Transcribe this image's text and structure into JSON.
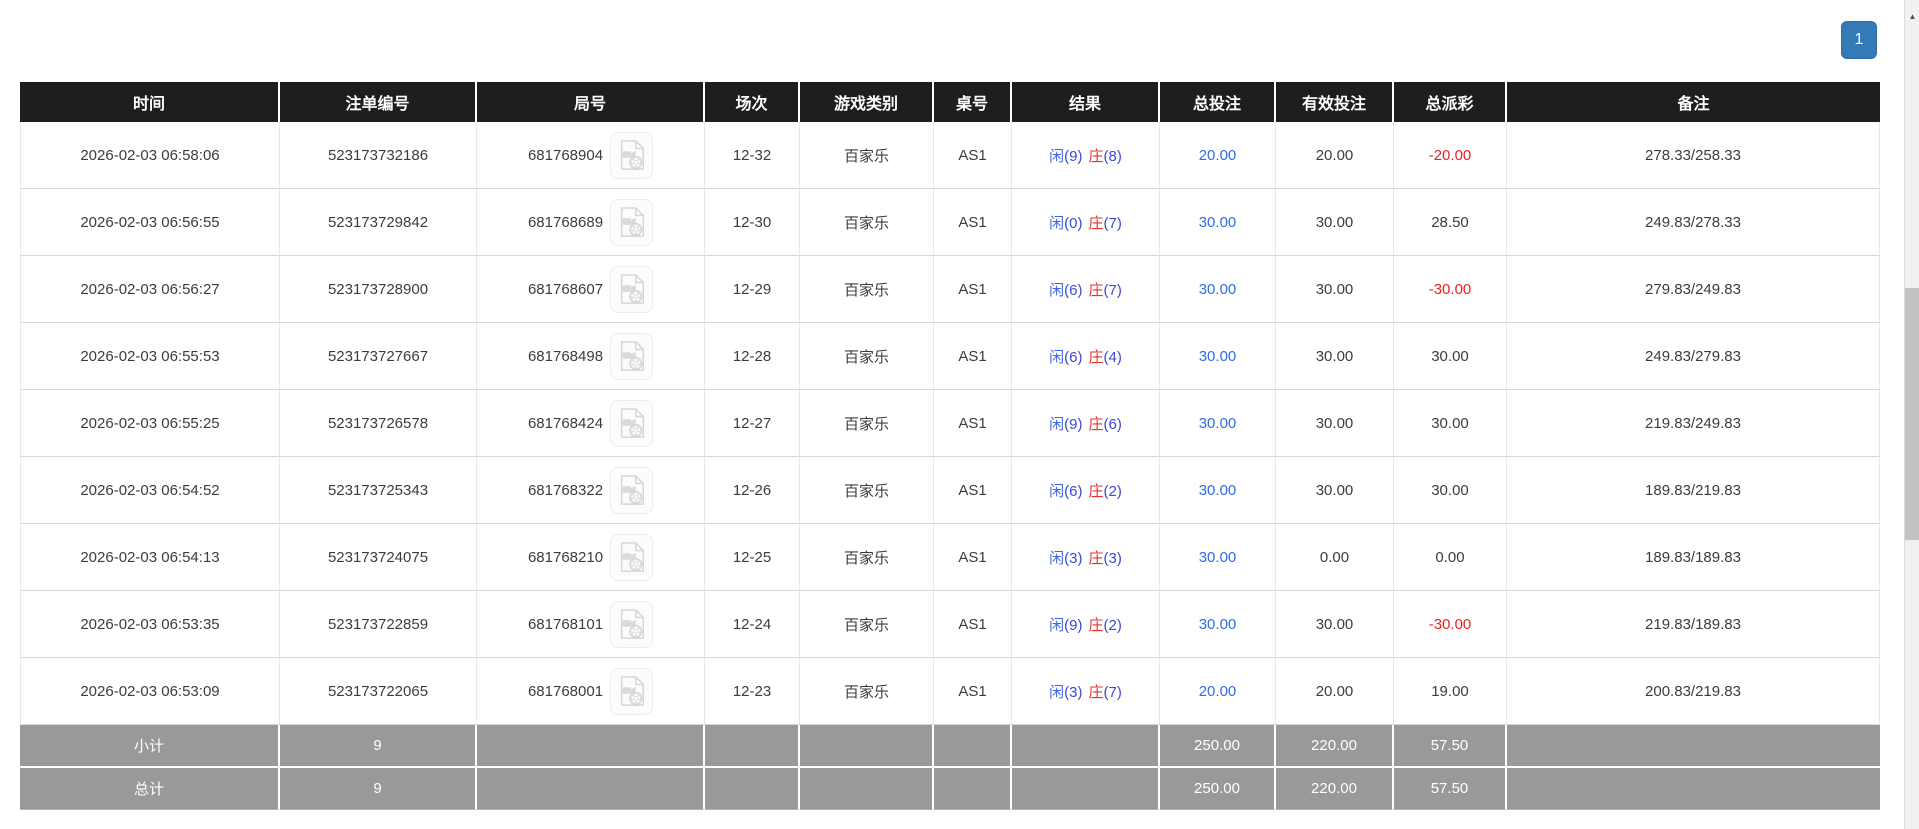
{
  "pagination": {
    "page_label": "1"
  },
  "icons": {
    "video_replay": "video-file-icon",
    "scroll_up": "▲"
  },
  "colors": {
    "header_bg": "#1e1e1e",
    "footer_bg": "#999999",
    "pagination_blue": "#337ab7",
    "total_bet_link_blue": "#2f6ce8",
    "player_blue": "#3f66e8",
    "banker_red": "#e23333",
    "negative_red": "#ef1f1f"
  },
  "table": {
    "headers": [
      "时间",
      "注单编号",
      "局号",
      "场次",
      "游戏类别",
      "桌号",
      "结果",
      "总投注",
      "有效投注",
      "总派彩",
      "备注"
    ],
    "rows": [
      {
        "time": "2026-02-03 06:58:06",
        "bet_id": "523173732186",
        "round_id": "681768904",
        "session": "12-32",
        "game_type": "百家乐",
        "table_no": "AS1",
        "player_label": "闲",
        "player_score": "(9)",
        "banker_label": "庄",
        "banker_score": "(8)",
        "total_bet": "20.00",
        "valid_bet": "20.00",
        "payout": "-20.00",
        "payout_class": "payout-neg",
        "remark": "278.33/258.33"
      },
      {
        "time": "2026-02-03 06:56:55",
        "bet_id": "523173729842",
        "round_id": "681768689",
        "session": "12-30",
        "game_type": "百家乐",
        "table_no": "AS1",
        "player_label": "闲",
        "player_score": "(0)",
        "banker_label": "庄",
        "banker_score": "(7)",
        "total_bet": "30.00",
        "valid_bet": "30.00",
        "payout": "28.50",
        "payout_class": "payout-pos",
        "remark": "249.83/278.33"
      },
      {
        "time": "2026-02-03 06:56:27",
        "bet_id": "523173728900",
        "round_id": "681768607",
        "session": "12-29",
        "game_type": "百家乐",
        "table_no": "AS1",
        "player_label": "闲",
        "player_score": "(6)",
        "banker_label": "庄",
        "banker_score": "(7)",
        "total_bet": "30.00",
        "valid_bet": "30.00",
        "payout": "-30.00",
        "payout_class": "payout-neg",
        "remark": "279.83/249.83"
      },
      {
        "time": "2026-02-03 06:55:53",
        "bet_id": "523173727667",
        "round_id": "681768498",
        "session": "12-28",
        "game_type": "百家乐",
        "table_no": "AS1",
        "player_label": "闲",
        "player_score": "(6)",
        "banker_label": "庄",
        "banker_score": "(4)",
        "total_bet": "30.00",
        "valid_bet": "30.00",
        "payout": "30.00",
        "payout_class": "payout-pos",
        "remark": "249.83/279.83"
      },
      {
        "time": "2026-02-03 06:55:25",
        "bet_id": "523173726578",
        "round_id": "681768424",
        "session": "12-27",
        "game_type": "百家乐",
        "table_no": "AS1",
        "player_label": "闲",
        "player_score": "(9)",
        "banker_label": "庄",
        "banker_score": "(6)",
        "total_bet": "30.00",
        "valid_bet": "30.00",
        "payout": "30.00",
        "payout_class": "payout-pos",
        "remark": "219.83/249.83"
      },
      {
        "time": "2026-02-03 06:54:52",
        "bet_id": "523173725343",
        "round_id": "681768322",
        "session": "12-26",
        "game_type": "百家乐",
        "table_no": "AS1",
        "player_label": "闲",
        "player_score": "(6)",
        "banker_label": "庄",
        "banker_score": "(2)",
        "total_bet": "30.00",
        "valid_bet": "30.00",
        "payout": "30.00",
        "payout_class": "payout-pos",
        "remark": "189.83/219.83"
      },
      {
        "time": "2026-02-03 06:54:13",
        "bet_id": "523173724075",
        "round_id": "681768210",
        "session": "12-25",
        "game_type": "百家乐",
        "table_no": "AS1",
        "player_label": "闲",
        "player_score": "(3)",
        "banker_label": "庄",
        "banker_score": "(3)",
        "total_bet": "30.00",
        "valid_bet": "0.00",
        "payout": "0.00",
        "payout_class": "payout-pos",
        "remark": "189.83/189.83"
      },
      {
        "time": "2026-02-03 06:53:35",
        "bet_id": "523173722859",
        "round_id": "681768101",
        "session": "12-24",
        "game_type": "百家乐",
        "table_no": "AS1",
        "player_label": "闲",
        "player_score": "(9)",
        "banker_label": "庄",
        "banker_score": "(2)",
        "total_bet": "30.00",
        "valid_bet": "30.00",
        "payout": "-30.00",
        "payout_class": "payout-neg",
        "remark": "219.83/189.83"
      },
      {
        "time": "2026-02-03 06:53:09",
        "bet_id": "523173722065",
        "round_id": "681768001",
        "session": "12-23",
        "game_type": "百家乐",
        "table_no": "AS1",
        "player_label": "闲",
        "player_score": "(3)",
        "banker_label": "庄",
        "banker_score": "(7)",
        "total_bet": "20.00",
        "valid_bet": "20.00",
        "payout": "19.00",
        "payout_class": "payout-pos",
        "remark": "200.83/219.83"
      }
    ],
    "subtotal": {
      "label": "小计",
      "count": "9",
      "total_bet": "250.00",
      "valid_bet": "220.00",
      "payout": "57.50"
    },
    "total": {
      "label": "总计",
      "count": "9",
      "total_bet": "250.00",
      "valid_bet": "220.00",
      "payout": "57.50"
    }
  }
}
